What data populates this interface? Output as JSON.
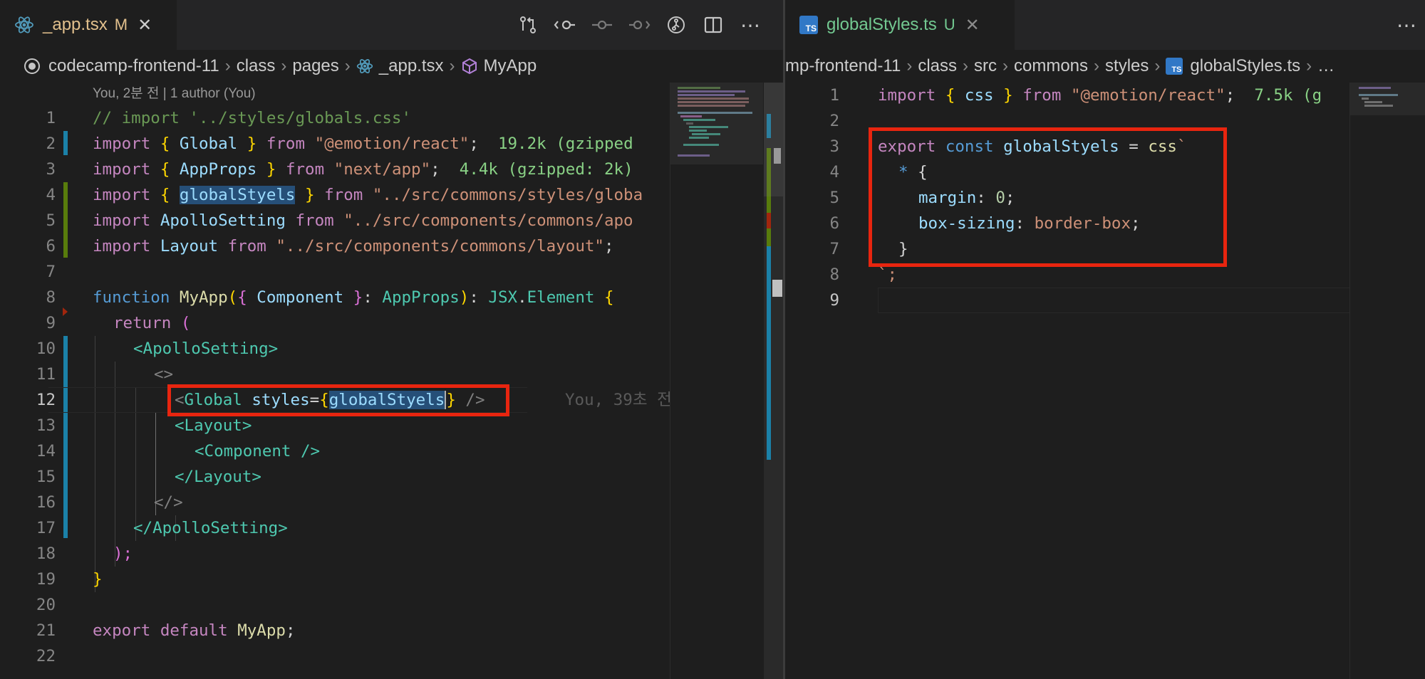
{
  "left_editor": {
    "tab": {
      "icon": "react-icon",
      "filename": "_app.tsx",
      "status": "M"
    },
    "actions": [
      "git-compare-icon",
      "go-back-icon",
      "timeline-icon",
      "go-forward-icon",
      "git-lens-icon",
      "split-editor-icon",
      "more-icon"
    ],
    "breadcrumb": [
      {
        "icon": "folder-root-icon",
        "label": "codecamp-frontend-11"
      },
      {
        "label": "class"
      },
      {
        "label": "pages"
      },
      {
        "icon": "react-icon",
        "label": "_app.tsx"
      },
      {
        "icon": "cube-icon",
        "label": "MyApp"
      }
    ],
    "codelens": "You, 2분 전 | 1 author (You)",
    "line_numbers": [
      "1",
      "2",
      "3",
      "4",
      "5",
      "6",
      "7",
      "8",
      "9",
      "10",
      "11",
      "12",
      "13",
      "14",
      "15",
      "16",
      "17",
      "18",
      "19",
      "20",
      "21",
      "22"
    ],
    "inline_blame": "You, 39초 전",
    "size_hints": [
      "19.2k (gzipped",
      "4.4k (gzipped: 2k)"
    ],
    "code": {
      "l1": "// import '../styles/globals.css'",
      "l2_kw": "import",
      "l2_open": "{",
      "l2_name": "Global",
      "l2_close": "}",
      "l2_from": "from",
      "l2_src": "\"@emotion/react\"",
      "l2_semi": ";",
      "l3_kw": "import",
      "l3_open": "{",
      "l3_name": "AppProps",
      "l3_close": "}",
      "l3_from": "from",
      "l3_src": "\"next/app\"",
      "l3_semi": ";",
      "l4_kw": "import",
      "l4_open": "{",
      "l4_name": "globalStyels",
      "l4_close": "}",
      "l4_from": "from",
      "l4_src": "\"../src/commons/styles/globa",
      "l5_kw": "import",
      "l5_name": "ApolloSetting",
      "l5_from": "from",
      "l5_src": "\"../src/components/commons/apo",
      "l6_kw": "import",
      "l6_name": "Layout",
      "l6_from": "from",
      "l6_src": "\"../src/components/commons/layout\"",
      "l6_semi": ";",
      "l8_fn": "function",
      "l8_name": "MyApp",
      "l8_p1": "(",
      "l8_b1": "{",
      "l8_comp": "Component",
      "l8_b2": "}",
      "l8_colon": ":",
      "l8_type": "AppProps",
      "l8_p2": ")",
      "l8_colon2": ":",
      "l8_jsx": "JSX",
      "l8_dot": ".",
      "l8_el": "Element",
      "l8_brace": "{",
      "l9_ret": "return",
      "l9_paren": "(",
      "l10": "<ApolloSetting>",
      "l11": "<>",
      "l12_lt": "<",
      "l12_tag": "Global",
      "l12_attr": "styles",
      "l12_eq": "=",
      "l12_ob": "{",
      "l12_val": "globalStyels",
      "l12_cb": "}",
      "l12_end": " />",
      "l13": "<Layout>",
      "l14": "<Component />",
      "l15": "</Layout>",
      "l16": "</>",
      "l17": "</ApolloSetting>",
      "l18": ");",
      "l19": "}",
      "l21_kw": "export",
      "l21_def": "default",
      "l21_name": "MyApp",
      "l21_semi": ";"
    }
  },
  "right_editor": {
    "tab": {
      "icon": "typescript-icon",
      "icon_text": "TS",
      "filename": "globalStyles.ts",
      "status": "U"
    },
    "actions": [
      "more-icon"
    ],
    "breadcrumb": [
      {
        "label": "mp-frontend-11"
      },
      {
        "label": "class"
      },
      {
        "label": "src"
      },
      {
        "label": "commons"
      },
      {
        "label": "styles"
      },
      {
        "icon": "typescript-icon",
        "label": "globalStyles.ts"
      },
      {
        "label": "…"
      }
    ],
    "line_numbers": [
      "1",
      "2",
      "3",
      "4",
      "5",
      "6",
      "7",
      "8",
      "9"
    ],
    "size_hint": "7.5k (g",
    "code": {
      "l1_kw": "import",
      "l1_open": "{",
      "l1_name": "css",
      "l1_close": "}",
      "l1_from": "from",
      "l1_src": "\"@emotion/react\"",
      "l1_semi": ";",
      "l3_kw": "export",
      "l3_const": "const",
      "l3_name": "globalStyels",
      "l3_eq": "=",
      "l3_css": "css",
      "l3_tick": "`",
      "l4_star": "*",
      "l4_brace": "{",
      "l5_prop": "margin",
      "l5_colon": ":",
      "l5_val": "0",
      "l5_semi": ";",
      "l6_prop": "box-sizing",
      "l6_colon": ":",
      "l6_val": "border-box",
      "l6_semi": ";",
      "l7": "}",
      "l8": "`;"
    }
  },
  "colors": {
    "background": "#1e1e1e",
    "tabbar": "#252526",
    "highlight_box": "#e8250f",
    "modified": "#e2c08d",
    "untracked": "#73c991",
    "keyword": "#c586c0",
    "string": "#ce9178",
    "type": "#4ec9b0"
  }
}
